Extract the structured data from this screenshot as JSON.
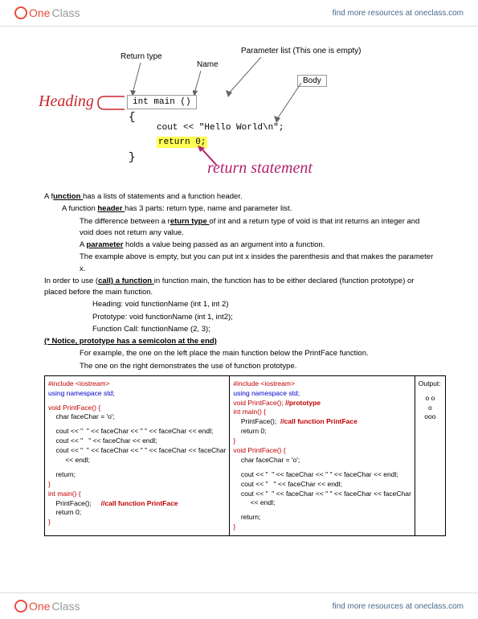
{
  "header": {
    "logo_one": "One",
    "logo_class": "Class",
    "resources_link": "find more resources at oneclass.com"
  },
  "diagram": {
    "return_type": "Return type",
    "name": "Name",
    "parameter_list": "Parameter list (This one is empty)",
    "body": "Body",
    "heading_handwritten": "Heading",
    "int_main": "int main ()",
    "cout_line": "cout << \"Hello World\\n\";",
    "return_line": "return 0;",
    "return_statement_handwritten": "return statement"
  },
  "body_text": {
    "p1_a": "A f",
    "p1_b": "unction ",
    "p1_c": "has a lists of statements and a function header.",
    "p2_a": "A function ",
    "p2_b": "header ",
    "p2_c": "has 3 parts: return type, name and parameter list.",
    "p3_a": "The difference between a r",
    "p3_b": "eturn type ",
    "p3_c": "of int and a return type of void is that int returns an integer and void does not return any value.",
    "p4_a": "A ",
    "p4_b": "parameter",
    "p4_c": " holds a value being passed as an argument into a function.",
    "p5": "The example above is empty, but you can put int x insides the parenthesis and that makes the parameter x.",
    "p6_a": "In order to use (",
    "p6_b": "call) a function ",
    "p6_c": "in function main, the function has to be either declared (function prototype) or placed before the main function.",
    "p7": "Heading: void functionName (int 1, int 2)",
    "p8": "Prototype: void functionName (int 1, int2);",
    "p9": "Function Call: functionName (2, 3);",
    "p10": "(* Notice, prototype has a semicolon at the end)",
    "p11": "For example, the one on the left place the main function below the PrintFace function.",
    "p12": "The one on the right demonstrates the use of function prototype."
  },
  "code_left": {
    "l1": "#include <iostream>",
    "l2": "using namespace std;",
    "l3": "void PrintFace() {",
    "l4": "    char faceChar = 'o';",
    "l5": "    cout << \"  \" << faceChar << \" \" << faceChar << endl;",
    "l6": "    cout << \"   \" << faceChar << endl;",
    "l7": "    cout << \"  \" << faceChar << \" \" << faceChar << faceChar",
    "l7b": "         << endl;",
    "l8": "    return;",
    "l9": "}",
    "l10": "int main() {",
    "l11a": "    PrintFace();",
    "l11b": "     //call function PrintFace",
    "l12": "    return 0;",
    "l13": "}"
  },
  "code_right": {
    "r1": "#include <iostream>",
    "r2": "using namespace std;",
    "r3a": "void PrintFace();",
    "r3b": "  //prototype",
    "r4": "int main() {",
    "r5a": "    PrintFace();",
    "r5b": "  //call function PrintFace",
    "r6": "    return 0;",
    "r7": "}",
    "r8": "void PrintFace() {",
    "r9": "    char faceChar = 'o';",
    "r10": "    cout << \"  \" << faceChar << \" \" << faceChar << endl;",
    "r11": "    cout << \"   \" << faceChar << endl;",
    "r12": "    cout << \"  \" << faceChar << \" \" << faceChar << faceChar",
    "r12b": "         << endl;",
    "r13": "    return;",
    "r14": "}"
  },
  "output": {
    "title": "Output:",
    "line1": "o o",
    "line2": "o",
    "line3": "ooo"
  }
}
